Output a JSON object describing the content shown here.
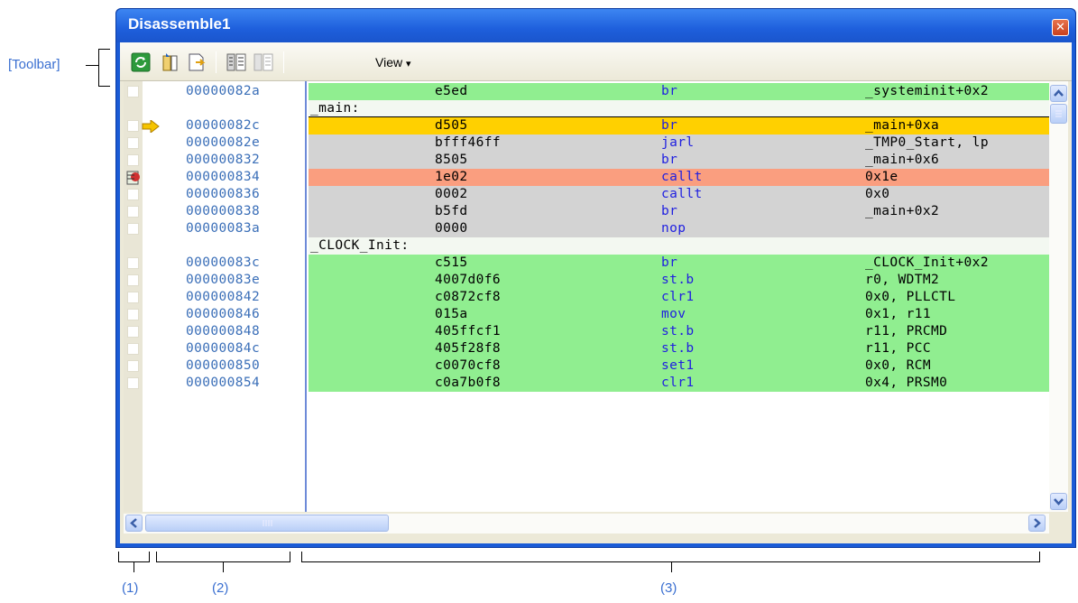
{
  "annotations": {
    "toolbar": "[Toolbar]",
    "area1": "(1)",
    "area2": "(2)",
    "area3": "(3)"
  },
  "window": {
    "title": "Disassemble1",
    "close_glyph": "✕"
  },
  "toolbar": {
    "buttons": [
      "refresh-icon",
      "go-to-symbol-icon",
      "save-icon",
      "show-code-icon",
      "show-offset-icon"
    ],
    "view_label": "View",
    "view_arrow": "▾"
  },
  "disassembly": [
    {
      "kind": "code",
      "address": "00000082a",
      "code": "e5ed",
      "mnemonic": "br",
      "operand": "_systeminit+0x2",
      "bg": "#90ee90"
    },
    {
      "kind": "label",
      "text": "_main:"
    },
    {
      "kind": "code",
      "address": "00000082c",
      "code": "d505",
      "mnemonic": "br",
      "operand": "_main+0xa",
      "bg": "#ffd000",
      "current_pc": true
    },
    {
      "kind": "code",
      "address": "00000082e",
      "code": "bfff46ff",
      "mnemonic": "jarl",
      "operand": "_TMP0_Start, lp",
      "bg": "#d3d3d3"
    },
    {
      "kind": "code",
      "address": "000000832",
      "code": "8505",
      "mnemonic": "br",
      "operand": "_main+0x6",
      "bg": "#d3d3d3"
    },
    {
      "kind": "code",
      "address": "000000834",
      "code": "1e02",
      "mnemonic": "callt",
      "operand": "0x1e",
      "bg": "#fa9e7f",
      "breakpoint": true
    },
    {
      "kind": "code",
      "address": "000000836",
      "code": "0002",
      "mnemonic": "callt",
      "operand": "0x0",
      "bg": "#d3d3d3"
    },
    {
      "kind": "code",
      "address": "000000838",
      "code": "b5fd",
      "mnemonic": "br",
      "operand": "_main+0x2",
      "bg": "#d3d3d3"
    },
    {
      "kind": "code",
      "address": "00000083a",
      "code": "0000",
      "mnemonic": "nop",
      "operand": "",
      "bg": "#d3d3d3"
    },
    {
      "kind": "label",
      "text": "_CLOCK_Init:"
    },
    {
      "kind": "code",
      "address": "00000083c",
      "code": "c515",
      "mnemonic": "br",
      "operand": "_CLOCK_Init+0x2",
      "bg": "#90ee90"
    },
    {
      "kind": "code",
      "address": "00000083e",
      "code": "4007d0f6",
      "mnemonic": "st.b",
      "operand": "r0, WDTM2",
      "bg": "#90ee90"
    },
    {
      "kind": "code",
      "address": "000000842",
      "code": "c0872cf8",
      "mnemonic": "clr1",
      "operand": "0x0, PLLCTL",
      "bg": "#90ee90"
    },
    {
      "kind": "code",
      "address": "000000846",
      "code": "015a",
      "mnemonic": "mov",
      "operand": "0x1, r11",
      "bg": "#90ee90"
    },
    {
      "kind": "code",
      "address": "000000848",
      "code": "405ffcf1",
      "mnemonic": "st.b",
      "operand": "r11, PRCMD",
      "bg": "#90ee90"
    },
    {
      "kind": "code",
      "address": "00000084c",
      "code": "405f28f8",
      "mnemonic": "st.b",
      "operand": "r11, PCC",
      "bg": "#90ee90"
    },
    {
      "kind": "code",
      "address": "000000850",
      "code": "c0070cf8",
      "mnemonic": "set1",
      "operand": "0x0, RCM",
      "bg": "#90ee90"
    },
    {
      "kind": "code",
      "address": "000000854",
      "code": "c0a7b0f8",
      "mnemonic": "clr1",
      "operand": "0x4, PRSM0",
      "bg": "#90ee90"
    }
  ],
  "scrollbars": {
    "up": "▲",
    "down": "▼",
    "left": "◀",
    "right": "▶"
  }
}
